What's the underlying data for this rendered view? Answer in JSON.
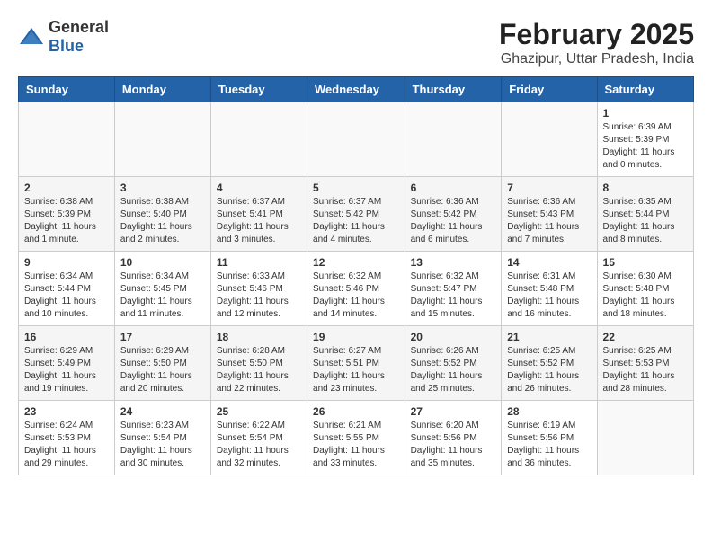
{
  "header": {
    "logo_general": "General",
    "logo_blue": "Blue",
    "month_year": "February 2025",
    "location": "Ghazipur, Uttar Pradesh, India"
  },
  "days_of_week": [
    "Sunday",
    "Monday",
    "Tuesday",
    "Wednesday",
    "Thursday",
    "Friday",
    "Saturday"
  ],
  "weeks": [
    [
      {
        "day": "",
        "info": ""
      },
      {
        "day": "",
        "info": ""
      },
      {
        "day": "",
        "info": ""
      },
      {
        "day": "",
        "info": ""
      },
      {
        "day": "",
        "info": ""
      },
      {
        "day": "",
        "info": ""
      },
      {
        "day": "1",
        "info": "Sunrise: 6:39 AM\nSunset: 5:39 PM\nDaylight: 11 hours\nand 0 minutes."
      }
    ],
    [
      {
        "day": "2",
        "info": "Sunrise: 6:38 AM\nSunset: 5:39 PM\nDaylight: 11 hours\nand 1 minute."
      },
      {
        "day": "3",
        "info": "Sunrise: 6:38 AM\nSunset: 5:40 PM\nDaylight: 11 hours\nand 2 minutes."
      },
      {
        "day": "4",
        "info": "Sunrise: 6:37 AM\nSunset: 5:41 PM\nDaylight: 11 hours\nand 3 minutes."
      },
      {
        "day": "5",
        "info": "Sunrise: 6:37 AM\nSunset: 5:42 PM\nDaylight: 11 hours\nand 4 minutes."
      },
      {
        "day": "6",
        "info": "Sunrise: 6:36 AM\nSunset: 5:42 PM\nDaylight: 11 hours\nand 6 minutes."
      },
      {
        "day": "7",
        "info": "Sunrise: 6:36 AM\nSunset: 5:43 PM\nDaylight: 11 hours\nand 7 minutes."
      },
      {
        "day": "8",
        "info": "Sunrise: 6:35 AM\nSunset: 5:44 PM\nDaylight: 11 hours\nand 8 minutes."
      }
    ],
    [
      {
        "day": "9",
        "info": "Sunrise: 6:34 AM\nSunset: 5:44 PM\nDaylight: 11 hours\nand 10 minutes."
      },
      {
        "day": "10",
        "info": "Sunrise: 6:34 AM\nSunset: 5:45 PM\nDaylight: 11 hours\nand 11 minutes."
      },
      {
        "day": "11",
        "info": "Sunrise: 6:33 AM\nSunset: 5:46 PM\nDaylight: 11 hours\nand 12 minutes."
      },
      {
        "day": "12",
        "info": "Sunrise: 6:32 AM\nSunset: 5:46 PM\nDaylight: 11 hours\nand 14 minutes."
      },
      {
        "day": "13",
        "info": "Sunrise: 6:32 AM\nSunset: 5:47 PM\nDaylight: 11 hours\nand 15 minutes."
      },
      {
        "day": "14",
        "info": "Sunrise: 6:31 AM\nSunset: 5:48 PM\nDaylight: 11 hours\nand 16 minutes."
      },
      {
        "day": "15",
        "info": "Sunrise: 6:30 AM\nSunset: 5:48 PM\nDaylight: 11 hours\nand 18 minutes."
      }
    ],
    [
      {
        "day": "16",
        "info": "Sunrise: 6:29 AM\nSunset: 5:49 PM\nDaylight: 11 hours\nand 19 minutes."
      },
      {
        "day": "17",
        "info": "Sunrise: 6:29 AM\nSunset: 5:50 PM\nDaylight: 11 hours\nand 20 minutes."
      },
      {
        "day": "18",
        "info": "Sunrise: 6:28 AM\nSunset: 5:50 PM\nDaylight: 11 hours\nand 22 minutes."
      },
      {
        "day": "19",
        "info": "Sunrise: 6:27 AM\nSunset: 5:51 PM\nDaylight: 11 hours\nand 23 minutes."
      },
      {
        "day": "20",
        "info": "Sunrise: 6:26 AM\nSunset: 5:52 PM\nDaylight: 11 hours\nand 25 minutes."
      },
      {
        "day": "21",
        "info": "Sunrise: 6:25 AM\nSunset: 5:52 PM\nDaylight: 11 hours\nand 26 minutes."
      },
      {
        "day": "22",
        "info": "Sunrise: 6:25 AM\nSunset: 5:53 PM\nDaylight: 11 hours\nand 28 minutes."
      }
    ],
    [
      {
        "day": "23",
        "info": "Sunrise: 6:24 AM\nSunset: 5:53 PM\nDaylight: 11 hours\nand 29 minutes."
      },
      {
        "day": "24",
        "info": "Sunrise: 6:23 AM\nSunset: 5:54 PM\nDaylight: 11 hours\nand 30 minutes."
      },
      {
        "day": "25",
        "info": "Sunrise: 6:22 AM\nSunset: 5:54 PM\nDaylight: 11 hours\nand 32 minutes."
      },
      {
        "day": "26",
        "info": "Sunrise: 6:21 AM\nSunset: 5:55 PM\nDaylight: 11 hours\nand 33 minutes."
      },
      {
        "day": "27",
        "info": "Sunrise: 6:20 AM\nSunset: 5:56 PM\nDaylight: 11 hours\nand 35 minutes."
      },
      {
        "day": "28",
        "info": "Sunrise: 6:19 AM\nSunset: 5:56 PM\nDaylight: 11 hours\nand 36 minutes."
      },
      {
        "day": "",
        "info": ""
      }
    ]
  ]
}
